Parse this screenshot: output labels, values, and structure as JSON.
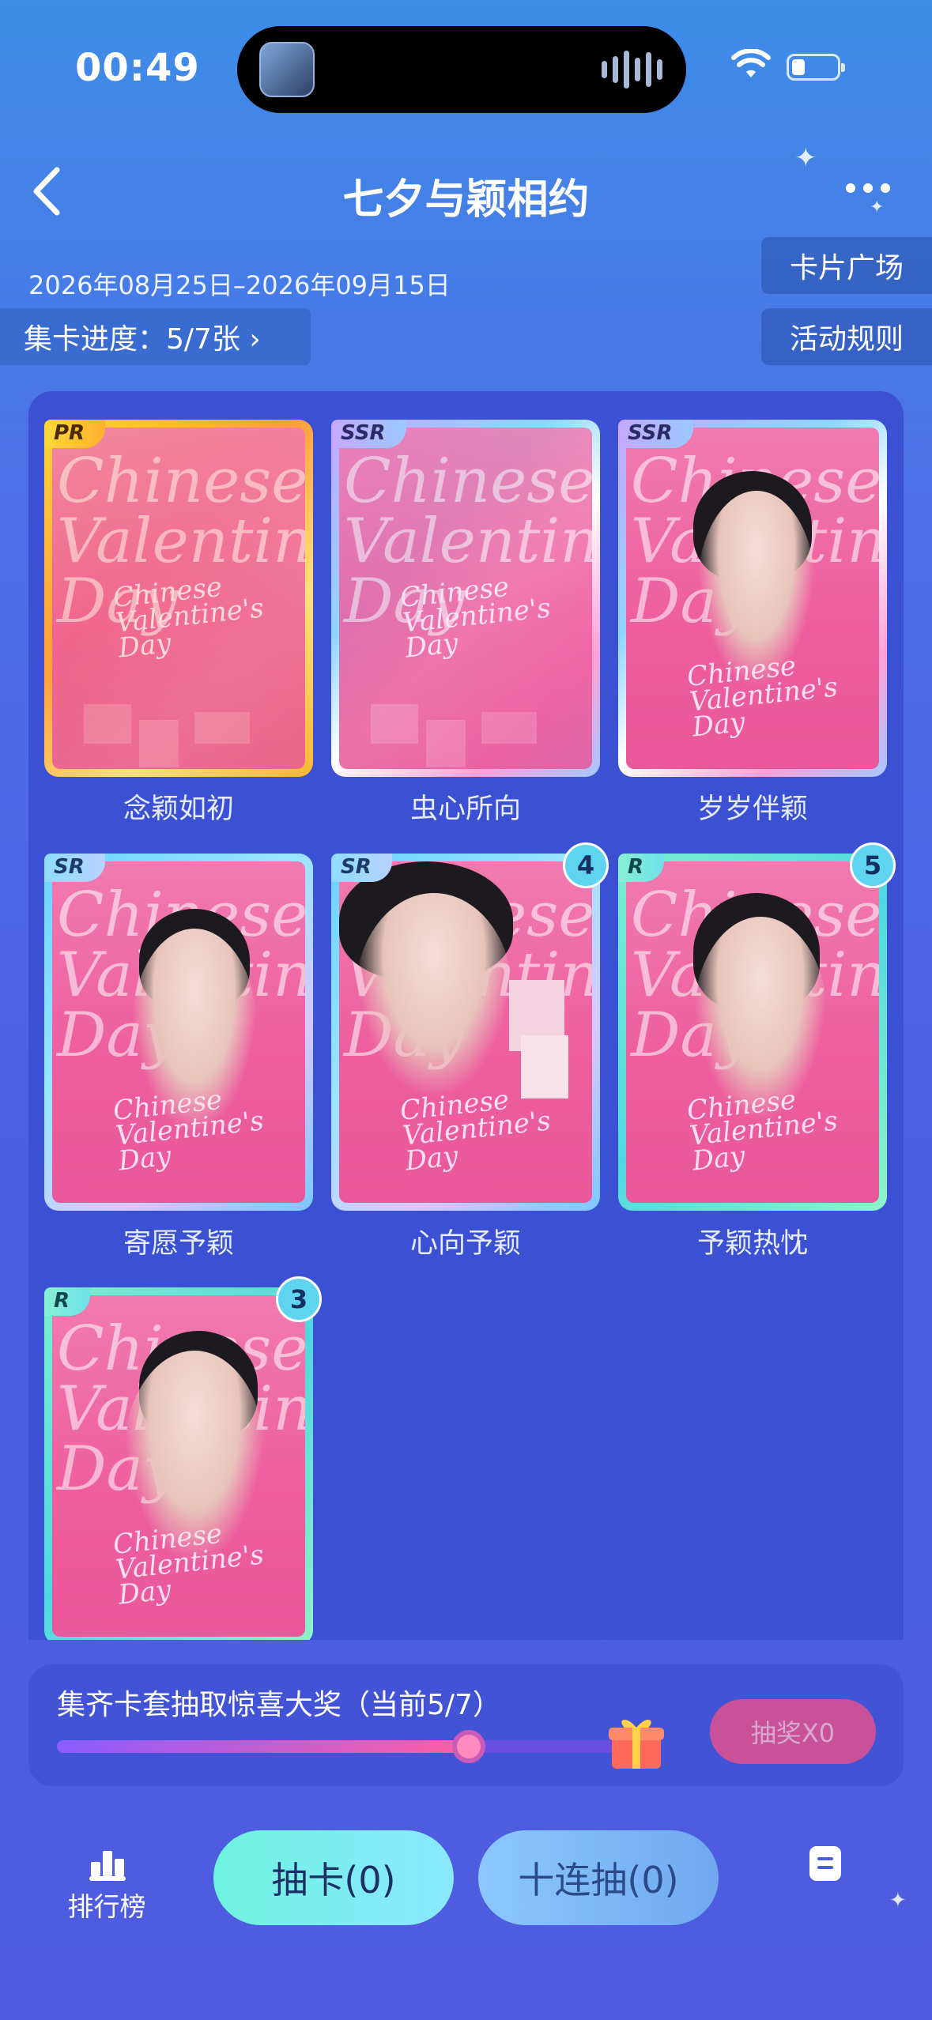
{
  "status_bar": {
    "time": "00:49"
  },
  "header": {
    "title": "七夕与颖相约",
    "date_range": "2026年08月25日–2026年09月15日",
    "progress_label": "集卡进度：5/7张 ›",
    "card_plaza": "卡片广场",
    "rules": "活动规则"
  },
  "cards": [
    {
      "name": "念颖如初",
      "rarity": "PR",
      "count": "",
      "owned": false
    },
    {
      "name": "虫心所向",
      "rarity": "SSR",
      "count": "",
      "owned": false
    },
    {
      "name": "岁岁伴颖",
      "rarity": "SSR",
      "count": "",
      "owned": true
    },
    {
      "name": "寄愿予颖",
      "rarity": "SR",
      "count": "",
      "owned": true
    },
    {
      "name": "心向予颖",
      "rarity": "SR",
      "count": "4",
      "owned": true
    },
    {
      "name": "予颖热忱",
      "rarity": "R",
      "count": "5",
      "owned": true
    },
    {
      "name": "",
      "rarity": "R",
      "count": "3",
      "owned": true
    }
  ],
  "card_art": {
    "script_large": "Chinese\nValentine\nDay",
    "script_small": "Chinese\nValentine's\nDay"
  },
  "lottery": {
    "text": "集齐卡套抽取惊喜大奖（当前5/7）",
    "progress": 0.714,
    "button": "抽奖X0"
  },
  "bottom_bar": {
    "rank_label": "排行榜",
    "draw_button": "抽卡(0)",
    "draw10_button": "十连抽(0)"
  },
  "colors": {
    "accent_cyan": "#6ff2e0",
    "panel_bg": "#3b50d2",
    "lottery_button": "#c8519a"
  }
}
